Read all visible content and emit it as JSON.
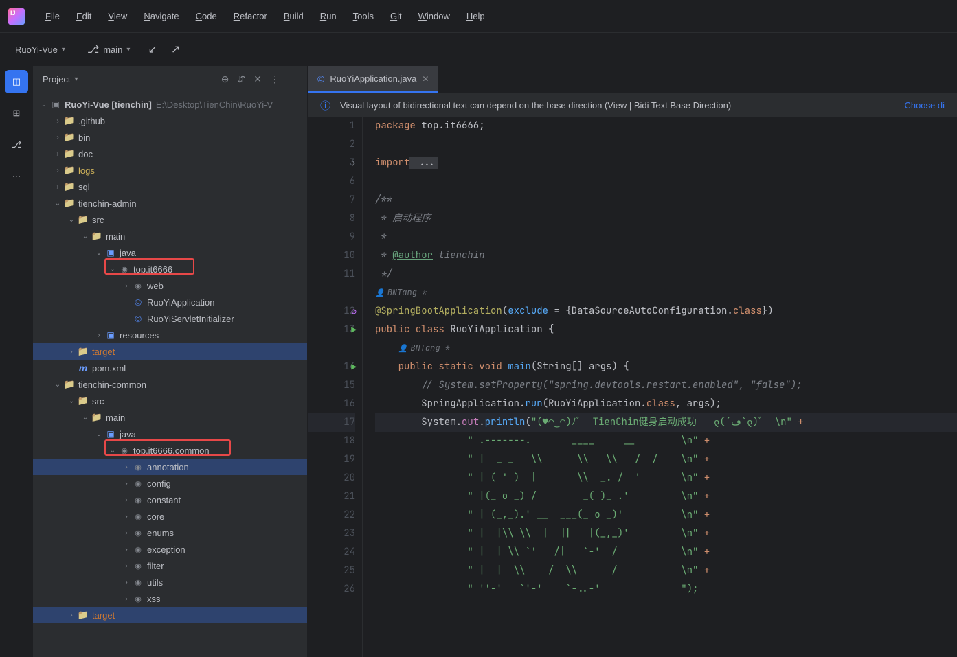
{
  "menu": [
    "File",
    "Edit",
    "View",
    "Navigate",
    "Code",
    "Refactor",
    "Build",
    "Run",
    "Tools",
    "Git",
    "Window",
    "Help"
  ],
  "toolrow": {
    "project": "RuoYi-Vue",
    "branch": "main"
  },
  "panel": {
    "title": "Project"
  },
  "tree": [
    {
      "d": 0,
      "a": "v",
      "i": "project",
      "t": "RuoYi-Vue [tienchin]",
      "cls": "bold",
      "path": "E:\\Desktop\\TienChin\\RuoYi-V"
    },
    {
      "d": 1,
      "a": ">",
      "i": "folder",
      "t": ".github"
    },
    {
      "d": 1,
      "a": ">",
      "i": "folder",
      "t": "bin"
    },
    {
      "d": 1,
      "a": ">",
      "i": "folder",
      "t": "doc"
    },
    {
      "d": 1,
      "a": ">",
      "i": "folder",
      "t": "logs",
      "cls": "yellow"
    },
    {
      "d": 1,
      "a": ">",
      "i": "folder",
      "t": "sql"
    },
    {
      "d": 1,
      "a": "v",
      "i": "folder",
      "t": "tienchin-admin"
    },
    {
      "d": 2,
      "a": "v",
      "i": "folder",
      "t": "src"
    },
    {
      "d": 3,
      "a": "v",
      "i": "folder",
      "t": "main"
    },
    {
      "d": 4,
      "a": "v",
      "i": "src",
      "t": "java"
    },
    {
      "d": 5,
      "a": "v",
      "i": "pkg",
      "t": "top.it6666",
      "box": 1
    },
    {
      "d": 6,
      "a": ">",
      "i": "pkg",
      "t": "web"
    },
    {
      "d": 6,
      "a": "",
      "i": "class",
      "t": "RuoYiApplication"
    },
    {
      "d": 6,
      "a": "",
      "i": "class",
      "t": "RuoYiServletInitializer"
    },
    {
      "d": 4,
      "a": ">",
      "i": "src",
      "t": "resources"
    },
    {
      "d": 2,
      "a": ">",
      "i": "folder",
      "t": "target",
      "cls": "orange",
      "row": "selected"
    },
    {
      "d": 2,
      "a": "",
      "i": "maven",
      "t": "pom.xml"
    },
    {
      "d": 1,
      "a": "v",
      "i": "folder",
      "t": "tienchin-common"
    },
    {
      "d": 2,
      "a": "v",
      "i": "folder",
      "t": "src"
    },
    {
      "d": 3,
      "a": "v",
      "i": "folder",
      "t": "main"
    },
    {
      "d": 4,
      "a": "v",
      "i": "src",
      "t": "java"
    },
    {
      "d": 5,
      "a": "v",
      "i": "pkg",
      "t": "top.it6666.common",
      "box": 2
    },
    {
      "d": 6,
      "a": ">",
      "i": "pkg",
      "t": "annotation",
      "row": "selected"
    },
    {
      "d": 6,
      "a": ">",
      "i": "pkg",
      "t": "config"
    },
    {
      "d": 6,
      "a": ">",
      "i": "pkg",
      "t": "constant"
    },
    {
      "d": 6,
      "a": ">",
      "i": "pkg",
      "t": "core"
    },
    {
      "d": 6,
      "a": ">",
      "i": "pkg",
      "t": "enums"
    },
    {
      "d": 6,
      "a": ">",
      "i": "pkg",
      "t": "exception"
    },
    {
      "d": 6,
      "a": ">",
      "i": "pkg",
      "t": "filter"
    },
    {
      "d": 6,
      "a": ">",
      "i": "pkg",
      "t": "utils"
    },
    {
      "d": 6,
      "a": ">",
      "i": "pkg",
      "t": "xss"
    },
    {
      "d": 2,
      "a": ">",
      "i": "folder",
      "t": "target",
      "cls": "orange",
      "row": "selected"
    }
  ],
  "tab": {
    "name": "RuoYiApplication.java"
  },
  "banner": {
    "text": "Visual layout of bidirectional text can depend on the base direction (View | Bidi Text Base Direction)",
    "link": "Choose di"
  },
  "gutter_lines": [
    {
      "n": "1"
    },
    {
      "n": "2"
    },
    {
      "n": "3",
      "ico": "fold"
    },
    {
      "n": "6"
    },
    {
      "n": "7"
    },
    {
      "n": "8"
    },
    {
      "n": "9"
    },
    {
      "n": "10"
    },
    {
      "n": "11"
    },
    {
      "n": ""
    },
    {
      "n": "12",
      "ico": "warn"
    },
    {
      "n": "13",
      "ico": "run"
    },
    {
      "n": ""
    },
    {
      "n": "14",
      "ico": "run"
    },
    {
      "n": "15"
    },
    {
      "n": "16"
    },
    {
      "n": "17",
      "hl": true
    },
    {
      "n": "18"
    },
    {
      "n": "19"
    },
    {
      "n": "20"
    },
    {
      "n": "21"
    },
    {
      "n": "22"
    },
    {
      "n": "23"
    },
    {
      "n": "24"
    },
    {
      "n": "25"
    },
    {
      "n": "26"
    }
  ],
  "code": {
    "pkg_kw": "package",
    "pkg_name": " top.it6666;",
    "import_kw": "import",
    "import_rest": " ...",
    "c1": "/**",
    "c2": " * 启动程序",
    "c3": " *",
    "c4_a": " * ",
    "c4_tag": "@author",
    "c4_b": " tienchin",
    "c5": " */",
    "inlay1": "BNTang *",
    "ann_name": "@SpringBootApplication",
    "ann_rest_a": "(",
    "ann_exclude": "exclude",
    "ann_rest_b": " = {DataSourceAutoConfiguration.",
    "ann_class": "class",
    "ann_rest_c": "})",
    "pub": "public ",
    "cls_kw": "class ",
    "cls_name": "RuoYiApplication ",
    "brace": "{",
    "inlay2": "BNTang *",
    "m_pub": "public ",
    "m_static": "static ",
    "m_void": "void ",
    "m_name": "main",
    "m_args": "(String[] ",
    "m_argn": "args",
    "m_end": ") {",
    "cmt_set": "// System.setProperty(\"spring.devtools.restart.enabled\", \"false\");",
    "run_a": "SpringApplication.",
    "run_fn": "run",
    "run_b": "(RuoYiApplication.",
    "run_class": "class",
    "run_c": ", ",
    "run_args": "args",
    "run_d": ");",
    "sys_a": "System.",
    "sys_out": "out",
    "sys_b": ".",
    "sys_fn": "println",
    "sys_c": "(",
    "str_main": "\"(♥◠‿◠)ﾉﾞ  TienChin健身启动成功   ლ(´ڡ`ლ)ﾞ  \\n\"",
    "plus": " +",
    "s1": "\" .-------.       ____     __        \\n\"",
    "s2": "\" |  _ _   \\\\      \\\\   \\\\   /  /    \\n\"",
    "s3": "\" | ( ' )  |       \\\\  _. /  '       \\n\"",
    "s4": "\" |(_ o _) /        _( )_ .'         \\n\"",
    "s5": "\" | (_,_).' __  ___(_ o _)'          \\n\"",
    "s6": "\" |  |\\\\ \\\\  |  ||   |(_,_)'         \\n\"",
    "s7": "\" |  | \\\\ `'   /|   `-'  /           \\n\"",
    "s8": "\" |  |  \\\\    /  \\\\      /           \\n\"",
    "s9": "\" ''-'   `'-'    `-..-'              \");"
  }
}
